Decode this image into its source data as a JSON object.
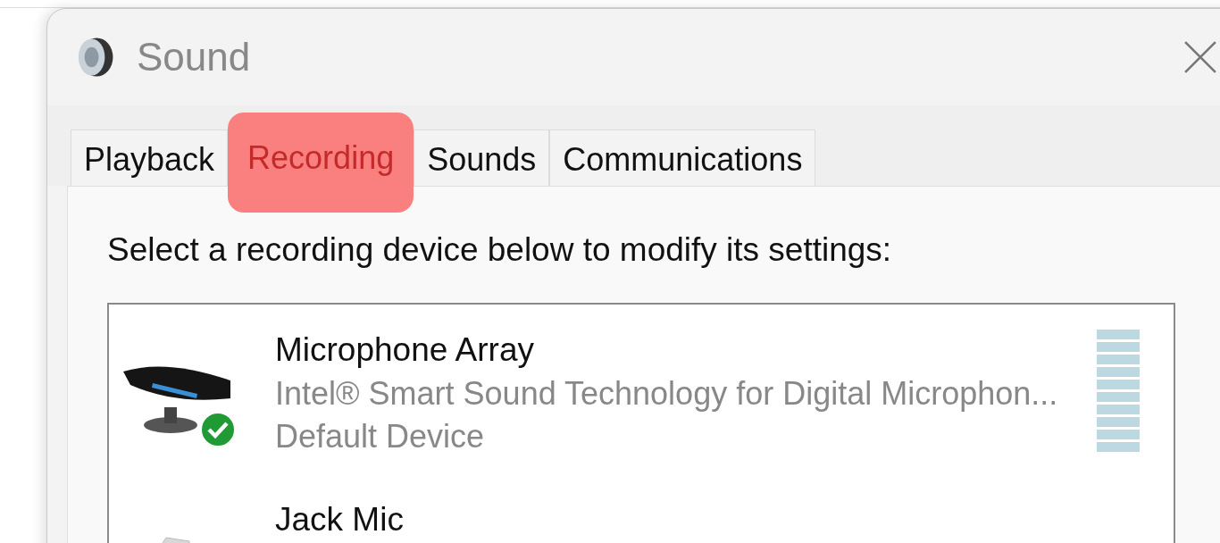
{
  "window": {
    "title": "Sound"
  },
  "tabs": [
    {
      "label": "Playback",
      "selected": false
    },
    {
      "label": "Recording",
      "selected": true
    },
    {
      "label": "Sounds",
      "selected": false
    },
    {
      "label": "Communications",
      "selected": false
    }
  ],
  "prompt": "Select a recording device below to modify its settings:",
  "devices": [
    {
      "kind": "array",
      "name": "Microphone Array",
      "description": "Intel® Smart Sound Technology for Digital Microphon...",
      "status": "Default Device",
      "default": true,
      "level": 0
    },
    {
      "kind": "jack",
      "name": "Jack Mic",
      "default": false
    }
  ]
}
